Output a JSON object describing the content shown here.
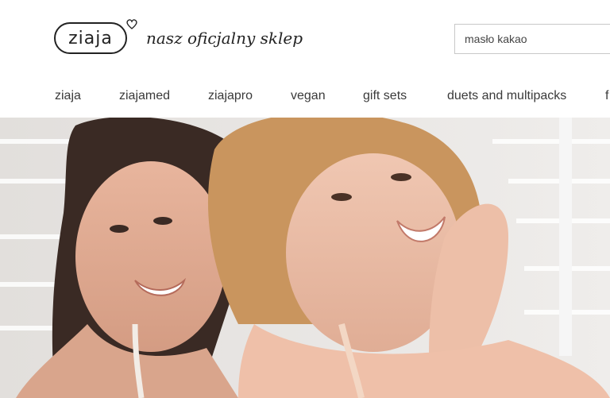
{
  "brand": {
    "logo_text": "ziaja",
    "tagline": "nasz oficjalny sklep"
  },
  "search": {
    "value": "masło kakao"
  },
  "nav": {
    "items": [
      {
        "label": "ziaja"
      },
      {
        "label": "ziajamed"
      },
      {
        "label": "ziajapro"
      },
      {
        "label": "vegan"
      },
      {
        "label": "gift sets"
      },
      {
        "label": "duets and multipacks"
      },
      {
        "label": "f"
      }
    ]
  },
  "icons": [
    "heart-icon"
  ],
  "colors": {
    "text": "#3a3a3a",
    "hero_bg": "#e9e6e3"
  }
}
